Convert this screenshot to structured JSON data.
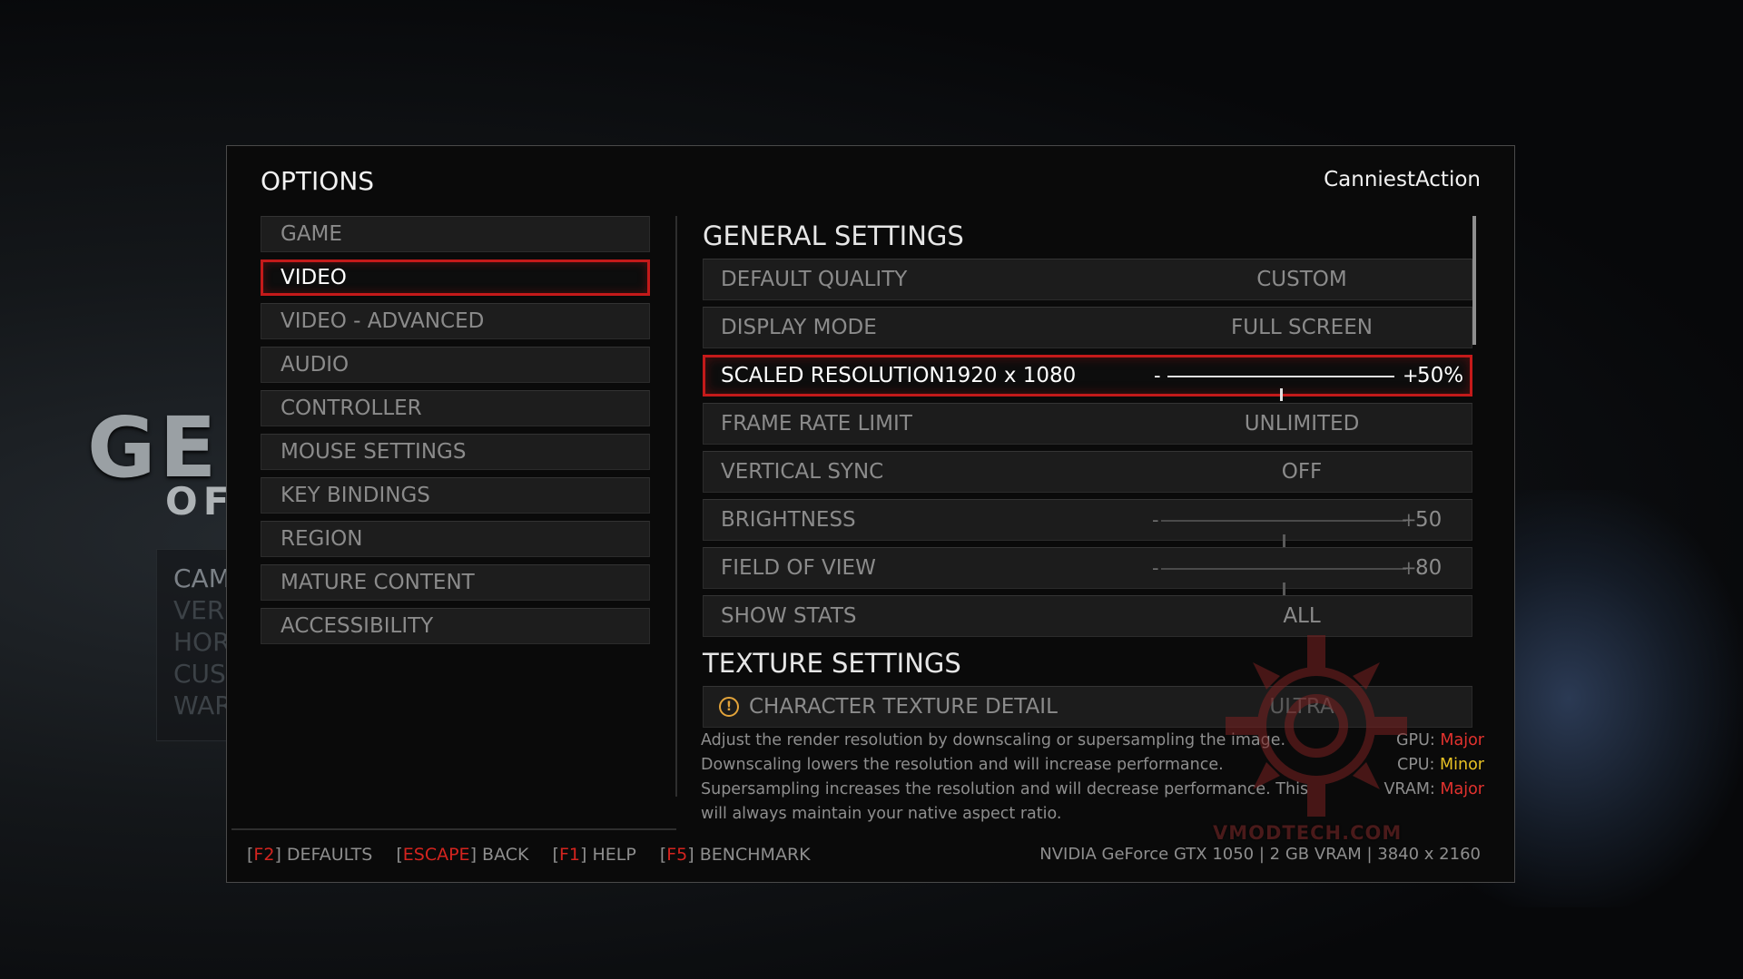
{
  "background": {
    "logo_big": "GE",
    "logo_small": "OF",
    "menu_items": [
      "CAM",
      "VER",
      "HOR",
      "CUS",
      "WAR"
    ]
  },
  "panel": {
    "title": "OPTIONS",
    "username": "CanniestAction"
  },
  "nav": {
    "items": [
      {
        "label": "GAME"
      },
      {
        "label": "VIDEO"
      },
      {
        "label": "VIDEO - ADVANCED"
      },
      {
        "label": "AUDIO"
      },
      {
        "label": "CONTROLLER"
      },
      {
        "label": "MOUSE SETTINGS"
      },
      {
        "label": "KEY BINDINGS"
      },
      {
        "label": "REGION"
      },
      {
        "label": "MATURE CONTENT"
      },
      {
        "label": "ACCESSIBILITY"
      }
    ],
    "selected": "VIDEO"
  },
  "general": {
    "heading": "GENERAL SETTINGS",
    "default_quality": {
      "label": "DEFAULT QUALITY",
      "value": "CUSTOM"
    },
    "display_mode": {
      "label": "DISPLAY MODE",
      "value": "FULL SCREEN"
    },
    "scaled_resolution": {
      "label": "SCALED RESOLUTION",
      "resolution": "1920 x 1080",
      "minus": "-",
      "plus": "+",
      "value_text": "50%",
      "fraction": 0.5
    },
    "frame_rate_limit": {
      "label": "FRAME RATE LIMIT",
      "value": "UNLIMITED"
    },
    "vertical_sync": {
      "label": "VERTICAL SYNC",
      "value": "OFF"
    },
    "brightness": {
      "label": "BRIGHTNESS",
      "minus": "-",
      "plus": "+",
      "value_text": "50",
      "fraction": 0.5
    },
    "field_of_view": {
      "label": "FIELD OF VIEW",
      "minus": "-",
      "plus": "+",
      "value_text": "80",
      "fraction": 0.5
    },
    "show_stats": {
      "label": "SHOW STATS",
      "value": "ALL"
    }
  },
  "texture": {
    "heading": "TEXTURE SETTINGS",
    "character_texture_detail": {
      "label": "CHARACTER TEXTURE DETAIL",
      "value": "ULTRA",
      "warning_icon": "warning-icon"
    }
  },
  "description": "Adjust the render resolution by downscaling or supersampling the image. Downscaling lowers the resolution and will increase performance. Supersampling increases the resolution and will decrease performance. This will always maintain your native aspect ratio.",
  "impact": {
    "gpu_label": "GPU:",
    "gpu_value": "Major",
    "cpu_label": "CPU:",
    "cpu_value": "Minor",
    "vram_label": "VRAM:",
    "vram_value": "Major"
  },
  "footer": {
    "defaults": {
      "key": "F2",
      "label": "DEFAULTS"
    },
    "back": {
      "key": "ESCAPE",
      "label": "BACK"
    },
    "help": {
      "key": "F1",
      "label": "HELP"
    },
    "benchmark": {
      "key": "F5",
      "label": "BENCHMARK"
    },
    "system_info": "NVIDIA GeForce GTX 1050 | 2 GB VRAM | 3840 x 2160"
  },
  "watermark": "VMODTECH.COM",
  "colors": {
    "accent_red": "#c41a1a",
    "major": "#e2322e",
    "minor": "#e8c224",
    "warning": "#e2a33a"
  }
}
